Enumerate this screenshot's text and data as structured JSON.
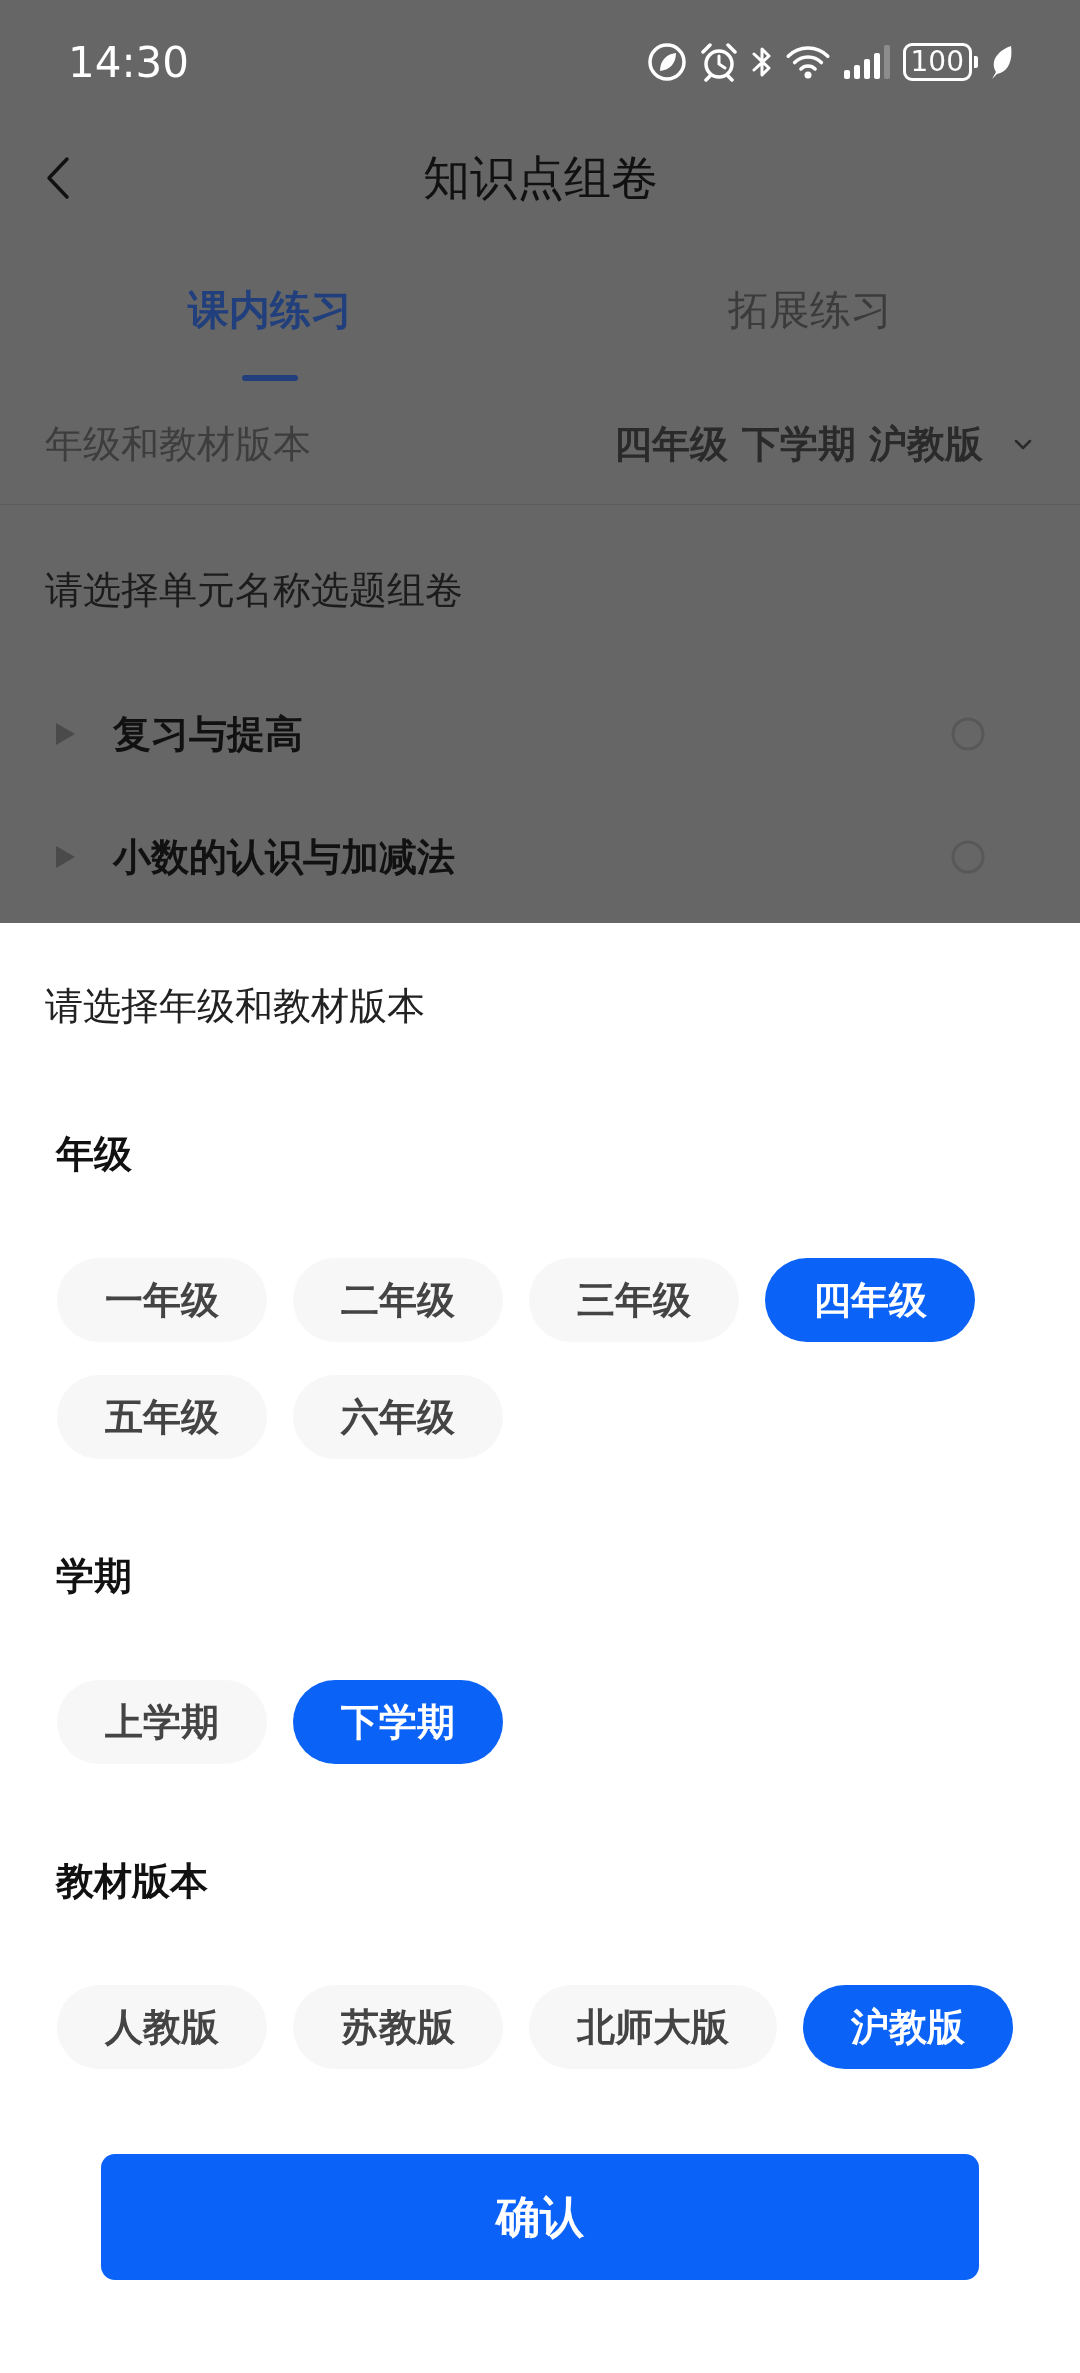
{
  "status_bar": {
    "time": "14:30",
    "battery": "100"
  },
  "header": {
    "title": "知识点组卷"
  },
  "tabs": [
    {
      "label": "课内练习",
      "selected": true
    },
    {
      "label": "拓展练习",
      "selected": false
    }
  ],
  "grade_row": {
    "label": "年级和教材版本",
    "value": "四年级 下学期 沪教版"
  },
  "unit_prompt": "请选择单元名称选题组卷",
  "units": [
    {
      "name": "复习与提高",
      "expanded": false,
      "selected": false
    },
    {
      "name": "小数的认识与加减法",
      "expanded": false,
      "selected": false
    }
  ],
  "sheet": {
    "title": "请选择年级和教材版本",
    "groups": [
      {
        "label": "年级",
        "options": [
          {
            "label": "一年级",
            "selected": false
          },
          {
            "label": "二年级",
            "selected": false
          },
          {
            "label": "三年级",
            "selected": false
          },
          {
            "label": "四年级",
            "selected": true
          },
          {
            "label": "五年级",
            "selected": false
          },
          {
            "label": "六年级",
            "selected": false
          }
        ]
      },
      {
        "label": "学期",
        "options": [
          {
            "label": "上学期",
            "selected": false
          },
          {
            "label": "下学期",
            "selected": true
          }
        ]
      },
      {
        "label": "教材版本",
        "options": [
          {
            "label": "人教版",
            "selected": false
          },
          {
            "label": "苏教版",
            "selected": false
          },
          {
            "label": "北师大版",
            "selected": false
          },
          {
            "label": "沪教版",
            "selected": true
          }
        ]
      }
    ],
    "confirm": "确认"
  }
}
